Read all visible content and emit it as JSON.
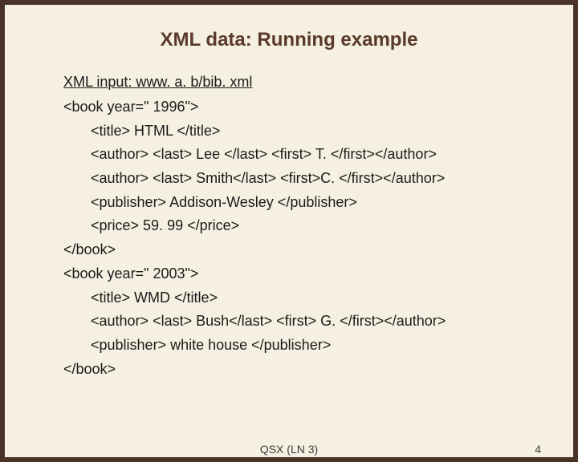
{
  "title": "XML data: Running example",
  "input_label": "XML input:  www. a. b/bib. xml",
  "lines": [
    {
      "text": "<book   year=\" 1996\">",
      "indent": false
    },
    {
      "text": "<title>  HTML </title>",
      "indent": true
    },
    {
      "text": "<author>  <last> Lee </last>  <first> T. </first></author>",
      "indent": true
    },
    {
      "text": "<author>  <last> Smith</last>  <first>C. </first></author>",
      "indent": true
    },
    {
      "text": "<publisher>  Addison-Wesley </publisher>",
      "indent": true
    },
    {
      "text": "<price>  59. 99 </price>",
      "indent": true
    },
    {
      "text": "</book>",
      "indent": false
    },
    {
      "text": "<book   year=\" 2003\">",
      "indent": false
    },
    {
      "text": "<title>  WMD </title>",
      "indent": true
    },
    {
      "text": "<author>  <last> Bush</last>  <first> G. </first></author>",
      "indent": true
    },
    {
      "text": "<publisher> white house </publisher>",
      "indent": true
    },
    {
      "text": "</book>",
      "indent": false
    }
  ],
  "footer_center": "QSX (LN 3)",
  "footer_right": "4"
}
